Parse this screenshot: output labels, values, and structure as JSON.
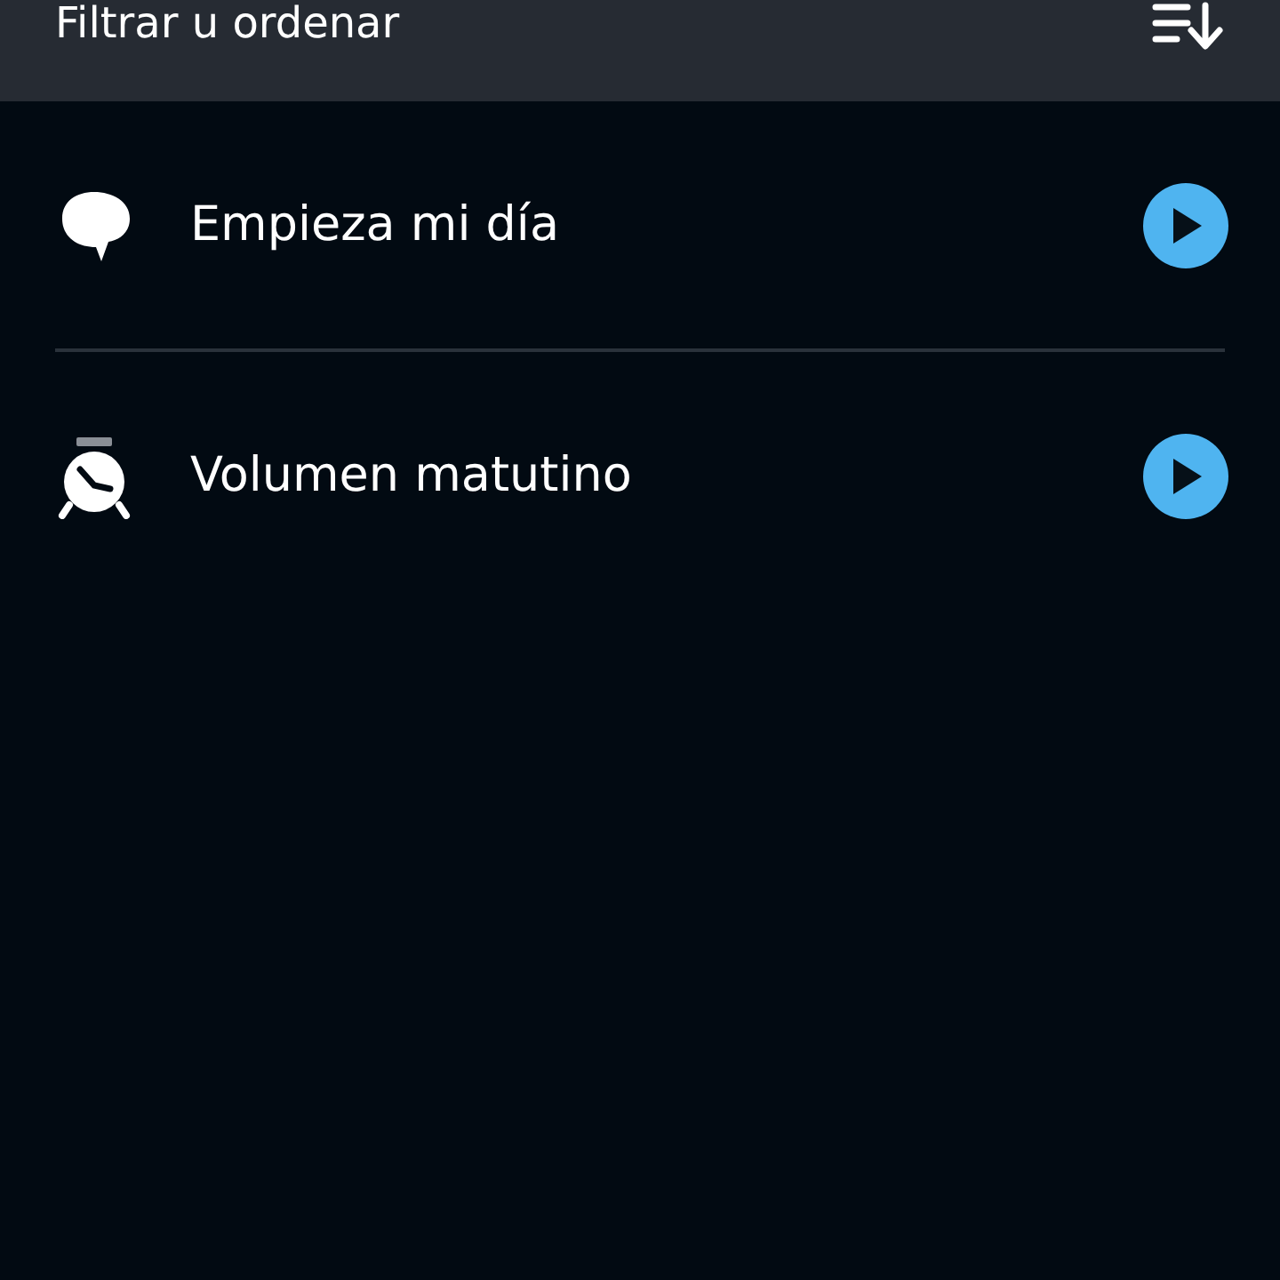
{
  "header": {
    "title": "Filtrar u ordenar"
  },
  "routines": [
    {
      "kind": "speech",
      "name": "Empieza mi día"
    },
    {
      "kind": "alarm",
      "name": "Volumen matutino"
    }
  ]
}
